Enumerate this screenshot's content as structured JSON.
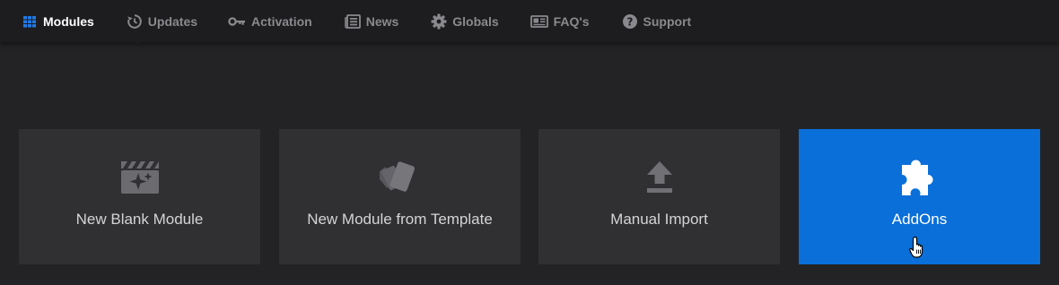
{
  "nav": {
    "items": [
      {
        "label": "Modules",
        "icon": "grid-icon",
        "active": true
      },
      {
        "label": "Updates",
        "icon": "updates-icon",
        "active": false
      },
      {
        "label": "Activation",
        "icon": "key-icon",
        "active": false
      },
      {
        "label": "News",
        "icon": "news-icon",
        "active": false
      },
      {
        "label": "Globals",
        "icon": "gear-icon",
        "active": false
      },
      {
        "label": "FAQ's",
        "icon": "faq-icon",
        "active": false
      },
      {
        "label": "Support",
        "icon": "support-icon",
        "active": false
      }
    ]
  },
  "cards": [
    {
      "label": "New Blank Module",
      "icon": "clapperboard-sparkle-icon"
    },
    {
      "label": "New Module from Template",
      "icon": "template-cards-icon"
    },
    {
      "label": "Manual Import",
      "icon": "upload-icon"
    },
    {
      "label": "AddOns",
      "icon": "puzzle-icon",
      "highlighted": true
    }
  ],
  "colors": {
    "background": "#232325",
    "nav_background": "#1d1d1f",
    "card_background": "#303033",
    "accent": "#0a6fd8",
    "nav_text": "#8a8a8e",
    "nav_active_text": "#ffffff",
    "active_icon": "#1e7be6"
  }
}
